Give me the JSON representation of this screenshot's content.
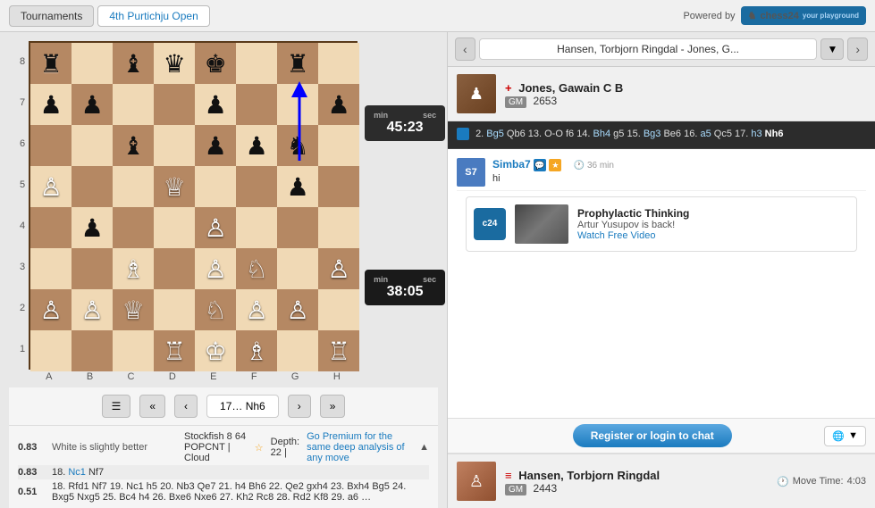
{
  "header": {
    "tournaments_label": "Tournaments",
    "active_tournament": "4th Purtichju Open",
    "powered_by_label": "Powered by",
    "chess24_label": "chess24"
  },
  "nav": {
    "game_title": "Hansen, Torbjorn Ringdal - Jones, G...",
    "prev_prev": "«",
    "prev": "‹",
    "next": "›",
    "next_next": "»",
    "current_move": "17… Nh6"
  },
  "players": {
    "top": {
      "name": "Jones, Gawain C B",
      "flag": "+",
      "country": "England",
      "title": "GM",
      "rating": "2653"
    },
    "bottom": {
      "name": "Hansen, Torbjorn Ringdal",
      "flag": "=",
      "country": "Norway",
      "title": "GM",
      "rating": "2443",
      "move_time_label": "Move Time:",
      "move_time": "4:03"
    }
  },
  "clocks": {
    "top": {
      "min": "45",
      "sec": "23",
      "min_label": "min",
      "sec_label": "sec"
    },
    "bottom": {
      "min": "38",
      "sec": "05",
      "min_label": "min",
      "sec_label": "sec"
    }
  },
  "notation": {
    "text": "2. Bg5 Qb6 13. O-O f6 14. Bh4 g5 15. Bg3 Be6 16. a5 Qc5 17. h3 Nh6"
  },
  "chat": {
    "messages": [
      {
        "username": "Simba7",
        "badges": [
          "chat",
          "star"
        ],
        "time": "36 min",
        "text": "hi"
      }
    ]
  },
  "ad": {
    "title": "Prophylactic Thinking",
    "subtitle": "Artur Yusupov is back!",
    "link": "Watch Free Video",
    "logo": "c24"
  },
  "register": {
    "label": "Register or login to chat",
    "lang": "🌐"
  },
  "analysis": {
    "rows": [
      {
        "score": "0.83",
        "desc": "White is slightly better",
        "engine": "Stockfish 8 64 POPCNT | Cloud",
        "cloud_badge": "★",
        "depth": "Depth: 22 |",
        "premium": "Go Premium for the same deep analysis of any move",
        "moves": ""
      },
      {
        "score": "0.83",
        "desc": "",
        "engine": "",
        "premium": "",
        "moves": "18. Nc1 Nf7"
      },
      {
        "score": "0.51",
        "desc": "",
        "engine": "",
        "premium": "",
        "moves": "18. Rfd1 Nf7 19. Nc1 h5 20. Nb3 Qe7 21. h4 Bh6 22. Qe2 gxh4 23. Bxh4 Bg5 24. Bxg5 Nxg5 25. Bc4 h4 26. Bxe6 Nxe6 27. Kh2 Rc8 28. Rd2 Kf8 29. a6 …"
      }
    ]
  },
  "board": {
    "ranks": [
      "8",
      "7",
      "6",
      "5",
      "4",
      "3",
      "2",
      "1"
    ],
    "files": [
      "A",
      "B",
      "C",
      "D",
      "E",
      "F",
      "G",
      "H"
    ],
    "pieces": {
      "description": "Chess position after 17...Nh6"
    }
  },
  "controls": {
    "menu_icon": "☰",
    "prev_prev": "«",
    "prev": "‹",
    "next": "›",
    "next_next": "»",
    "current_move": "17… Nh6"
  }
}
